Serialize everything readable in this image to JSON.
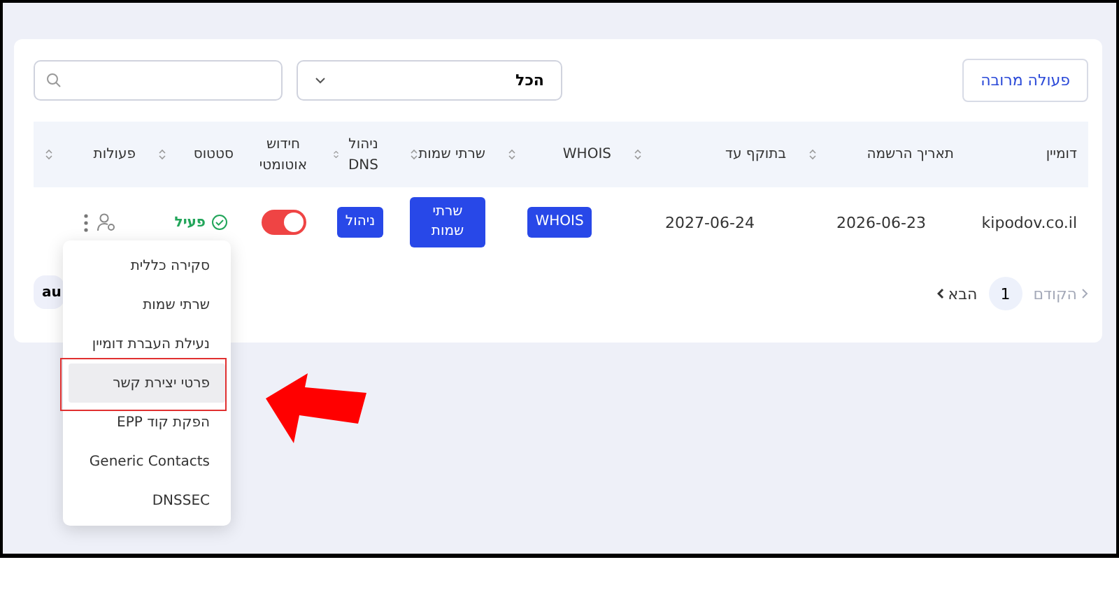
{
  "toolbar": {
    "bulk_action": "פעולה מרובה",
    "filter": "הכל"
  },
  "table": {
    "columns": [
      {
        "label": "דומיין",
        "sortable": false
      },
      {
        "label": "תאריך הרשמה",
        "sortable": true
      },
      {
        "label": "בתוקף עד",
        "sortable": true
      },
      {
        "label": "WHOIS",
        "sortable": true
      },
      {
        "label": "שרתי שמות",
        "sortable": true
      },
      {
        "label": "ניהול DNS",
        "sortable": true
      },
      {
        "label": "חידוש אוטומטי",
        "sortable": false
      },
      {
        "label": "סטטוס",
        "sortable": true
      },
      {
        "label": "פעולות",
        "sortable": true
      }
    ],
    "rows": [
      {
        "domain": "kipodov.co.il",
        "registered": "2026-06-23",
        "expires": "2027-06-24",
        "whois": "WHOIS",
        "nameservers": "שרתי שמות",
        "dns": "ניהול",
        "auto_renew": {
          "on": true
        },
        "status": "פעיל"
      }
    ]
  },
  "chip": "au",
  "pagination": {
    "prev": "הקודם",
    "pages": [
      {
        "label": "1",
        "selected": true
      }
    ],
    "next": "הבא"
  },
  "menu": {
    "items": [
      {
        "label": "סקירה כללית",
        "selected": false
      },
      {
        "label": "שרתי שמות",
        "selected": false
      },
      {
        "label": "נעילת העברת דומיין",
        "selected": false
      },
      {
        "label": "פרטי יצירת קשר",
        "selected": true
      },
      {
        "label": "הפקת קוד EPP",
        "selected": false
      },
      {
        "label": "Generic Contacts",
        "selected": false
      },
      {
        "label": "DNSSEC",
        "selected": false
      }
    ]
  }
}
